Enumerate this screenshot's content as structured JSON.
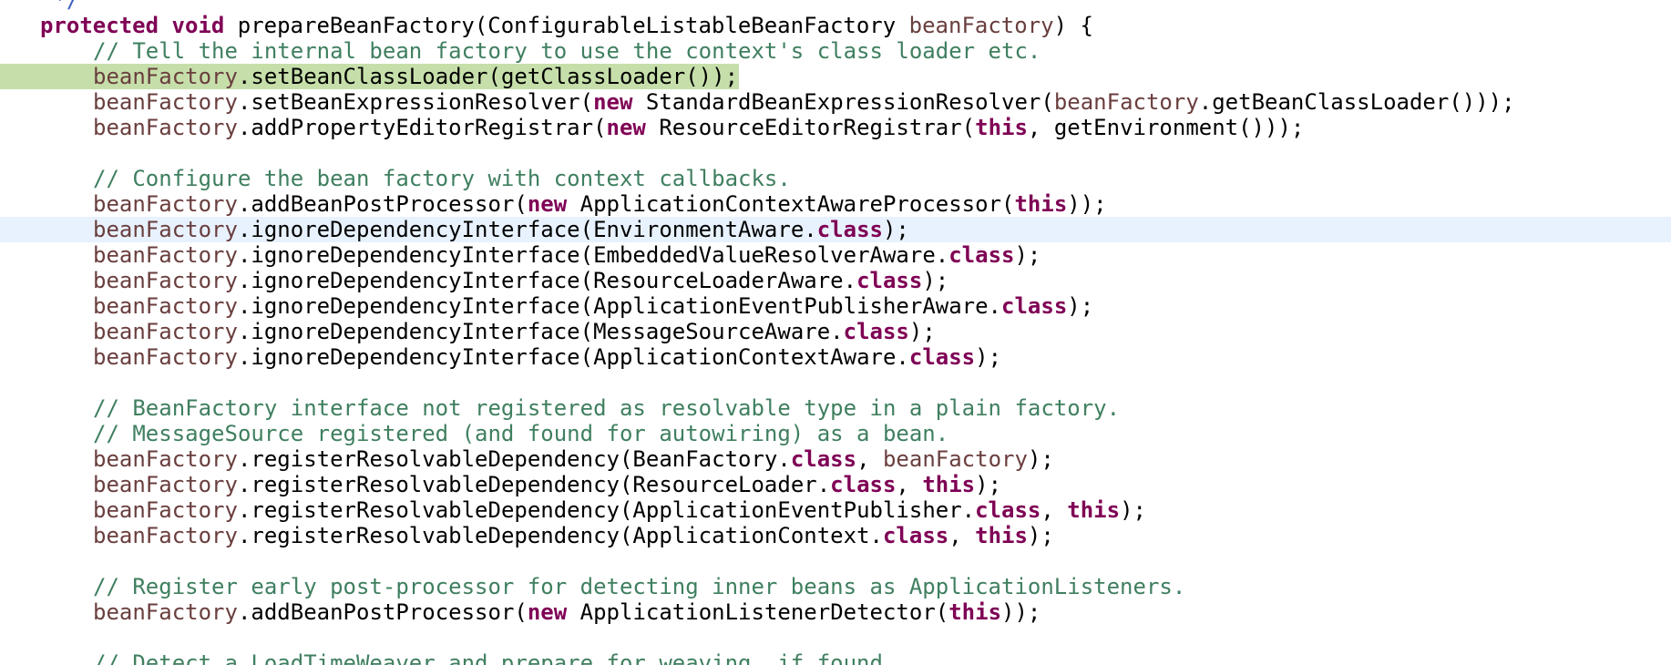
{
  "editor": {
    "colors": {
      "keyword": "#7f0055",
      "comment": "#3f7f5f",
      "javadoc": "#3f5fbf",
      "variable": "#6a3e3e",
      "current_line": "#e8f2fe",
      "execution_line": "#c6dfaa"
    },
    "lines": [
      {
        "indent": 1,
        "tokens": [
          {
            "t": " */",
            "c": "jd"
          }
        ]
      },
      {
        "indent": 0,
        "tokens": [
          {
            "t": "protected",
            "c": "kw"
          },
          {
            "t": " ",
            "c": "pl"
          },
          {
            "t": "void",
            "c": "kw"
          },
          {
            "t": " prepareBeanFactory(ConfigurableListableBeanFactory ",
            "c": "pl"
          },
          {
            "t": "beanFactory",
            "c": "vr"
          },
          {
            "t": ") {",
            "c": "pl"
          }
        ]
      },
      {
        "indent": 1,
        "tokens": [
          {
            "t": "// Tell the internal bean factory to use the context's class loader etc.",
            "c": "cm"
          }
        ]
      },
      {
        "indent": 1,
        "highlight": "exec",
        "tokens": [
          {
            "t": "beanFactory",
            "c": "vr"
          },
          {
            "t": ".setBeanClassLoader(getClassLoader());",
            "c": "pl"
          }
        ]
      },
      {
        "indent": 1,
        "tokens": [
          {
            "t": "beanFactory",
            "c": "vr"
          },
          {
            "t": ".setBeanExpressionResolver(",
            "c": "pl"
          },
          {
            "t": "new",
            "c": "kw"
          },
          {
            "t": " StandardBeanExpressionResolver(",
            "c": "pl"
          },
          {
            "t": "beanFactory",
            "c": "vr"
          },
          {
            "t": ".getBeanClassLoader()));",
            "c": "pl"
          }
        ]
      },
      {
        "indent": 1,
        "tokens": [
          {
            "t": "beanFactory",
            "c": "vr"
          },
          {
            "t": ".addPropertyEditorRegistrar(",
            "c": "pl"
          },
          {
            "t": "new",
            "c": "kw"
          },
          {
            "t": " ResourceEditorRegistrar(",
            "c": "pl"
          },
          {
            "t": "this",
            "c": "kw"
          },
          {
            "t": ", getEnvironment()));",
            "c": "pl"
          }
        ]
      },
      {
        "indent": 0,
        "tokens": []
      },
      {
        "indent": 1,
        "tokens": [
          {
            "t": "// Configure the bean factory with context callbacks.",
            "c": "cm"
          }
        ]
      },
      {
        "indent": 1,
        "tokens": [
          {
            "t": "beanFactory",
            "c": "vr"
          },
          {
            "t": ".addBeanPostProcessor(",
            "c": "pl"
          },
          {
            "t": "new",
            "c": "kw"
          },
          {
            "t": " ApplicationContextAwareProcessor(",
            "c": "pl"
          },
          {
            "t": "this",
            "c": "kw"
          },
          {
            "t": "));",
            "c": "pl"
          }
        ]
      },
      {
        "indent": 1,
        "highlight": "current",
        "tokens": [
          {
            "t": "beanFactory",
            "c": "vr"
          },
          {
            "t": ".ignoreDependencyInterface(EnvironmentAware.",
            "c": "pl"
          },
          {
            "t": "class",
            "c": "kw"
          },
          {
            "t": ");",
            "c": "pl"
          }
        ]
      },
      {
        "indent": 1,
        "tokens": [
          {
            "t": "beanFactory",
            "c": "vr"
          },
          {
            "t": ".ignoreDependencyInterface(EmbeddedValueResolverAware.",
            "c": "pl"
          },
          {
            "t": "class",
            "c": "kw"
          },
          {
            "t": ");",
            "c": "pl"
          }
        ]
      },
      {
        "indent": 1,
        "tokens": [
          {
            "t": "beanFactory",
            "c": "vr"
          },
          {
            "t": ".ignoreDependencyInterface(ResourceLoaderAware.",
            "c": "pl"
          },
          {
            "t": "class",
            "c": "kw"
          },
          {
            "t": ");",
            "c": "pl"
          }
        ]
      },
      {
        "indent": 1,
        "tokens": [
          {
            "t": "beanFactory",
            "c": "vr"
          },
          {
            "t": ".ignoreDependencyInterface(ApplicationEventPublisherAware.",
            "c": "pl"
          },
          {
            "t": "class",
            "c": "kw"
          },
          {
            "t": ");",
            "c": "pl"
          }
        ]
      },
      {
        "indent": 1,
        "tokens": [
          {
            "t": "beanFactory",
            "c": "vr"
          },
          {
            "t": ".ignoreDependencyInterface(MessageSourceAware.",
            "c": "pl"
          },
          {
            "t": "class",
            "c": "kw"
          },
          {
            "t": ");",
            "c": "pl"
          }
        ]
      },
      {
        "indent": 1,
        "tokens": [
          {
            "t": "beanFactory",
            "c": "vr"
          },
          {
            "t": ".ignoreDependencyInterface(ApplicationContextAware.",
            "c": "pl"
          },
          {
            "t": "class",
            "c": "kw"
          },
          {
            "t": ");",
            "c": "pl"
          }
        ]
      },
      {
        "indent": 0,
        "tokens": []
      },
      {
        "indent": 1,
        "tokens": [
          {
            "t": "// BeanFactory interface not registered as resolvable type in a plain factory.",
            "c": "cm"
          }
        ]
      },
      {
        "indent": 1,
        "tokens": [
          {
            "t": "// MessageSource registered (and found for autowiring) as a bean.",
            "c": "cm"
          }
        ]
      },
      {
        "indent": 1,
        "tokens": [
          {
            "t": "beanFactory",
            "c": "vr"
          },
          {
            "t": ".registerResolvableDependency(BeanFactory.",
            "c": "pl"
          },
          {
            "t": "class",
            "c": "kw"
          },
          {
            "t": ", ",
            "c": "pl"
          },
          {
            "t": "beanFactory",
            "c": "vr"
          },
          {
            "t": ");",
            "c": "pl"
          }
        ]
      },
      {
        "indent": 1,
        "tokens": [
          {
            "t": "beanFactory",
            "c": "vr"
          },
          {
            "t": ".registerResolvableDependency(ResourceLoader.",
            "c": "pl"
          },
          {
            "t": "class",
            "c": "kw"
          },
          {
            "t": ", ",
            "c": "pl"
          },
          {
            "t": "this",
            "c": "kw"
          },
          {
            "t": ");",
            "c": "pl"
          }
        ]
      },
      {
        "indent": 1,
        "tokens": [
          {
            "t": "beanFactory",
            "c": "vr"
          },
          {
            "t": ".registerResolvableDependency(ApplicationEventPublisher.",
            "c": "pl"
          },
          {
            "t": "class",
            "c": "kw"
          },
          {
            "t": ", ",
            "c": "pl"
          },
          {
            "t": "this",
            "c": "kw"
          },
          {
            "t": ");",
            "c": "pl"
          }
        ]
      },
      {
        "indent": 1,
        "tokens": [
          {
            "t": "beanFactory",
            "c": "vr"
          },
          {
            "t": ".registerResolvableDependency(ApplicationContext.",
            "c": "pl"
          },
          {
            "t": "class",
            "c": "kw"
          },
          {
            "t": ", ",
            "c": "pl"
          },
          {
            "t": "this",
            "c": "kw"
          },
          {
            "t": ");",
            "c": "pl"
          }
        ]
      },
      {
        "indent": 0,
        "tokens": []
      },
      {
        "indent": 1,
        "tokens": [
          {
            "t": "// Register early post-processor for detecting inner beans as ApplicationListeners.",
            "c": "cm"
          }
        ]
      },
      {
        "indent": 1,
        "tokens": [
          {
            "t": "beanFactory",
            "c": "vr"
          },
          {
            "t": ".addBeanPostProcessor(",
            "c": "pl"
          },
          {
            "t": "new",
            "c": "kw"
          },
          {
            "t": " ApplicationListenerDetector(",
            "c": "pl"
          },
          {
            "t": "this",
            "c": "kw"
          },
          {
            "t": "));",
            "c": "pl"
          }
        ]
      },
      {
        "indent": 0,
        "tokens": []
      },
      {
        "indent": 1,
        "tokens": [
          {
            "t": "// Detect a LoadTimeWeaver and prepare for weaving, if found.",
            "c": "cm"
          }
        ]
      }
    ]
  }
}
